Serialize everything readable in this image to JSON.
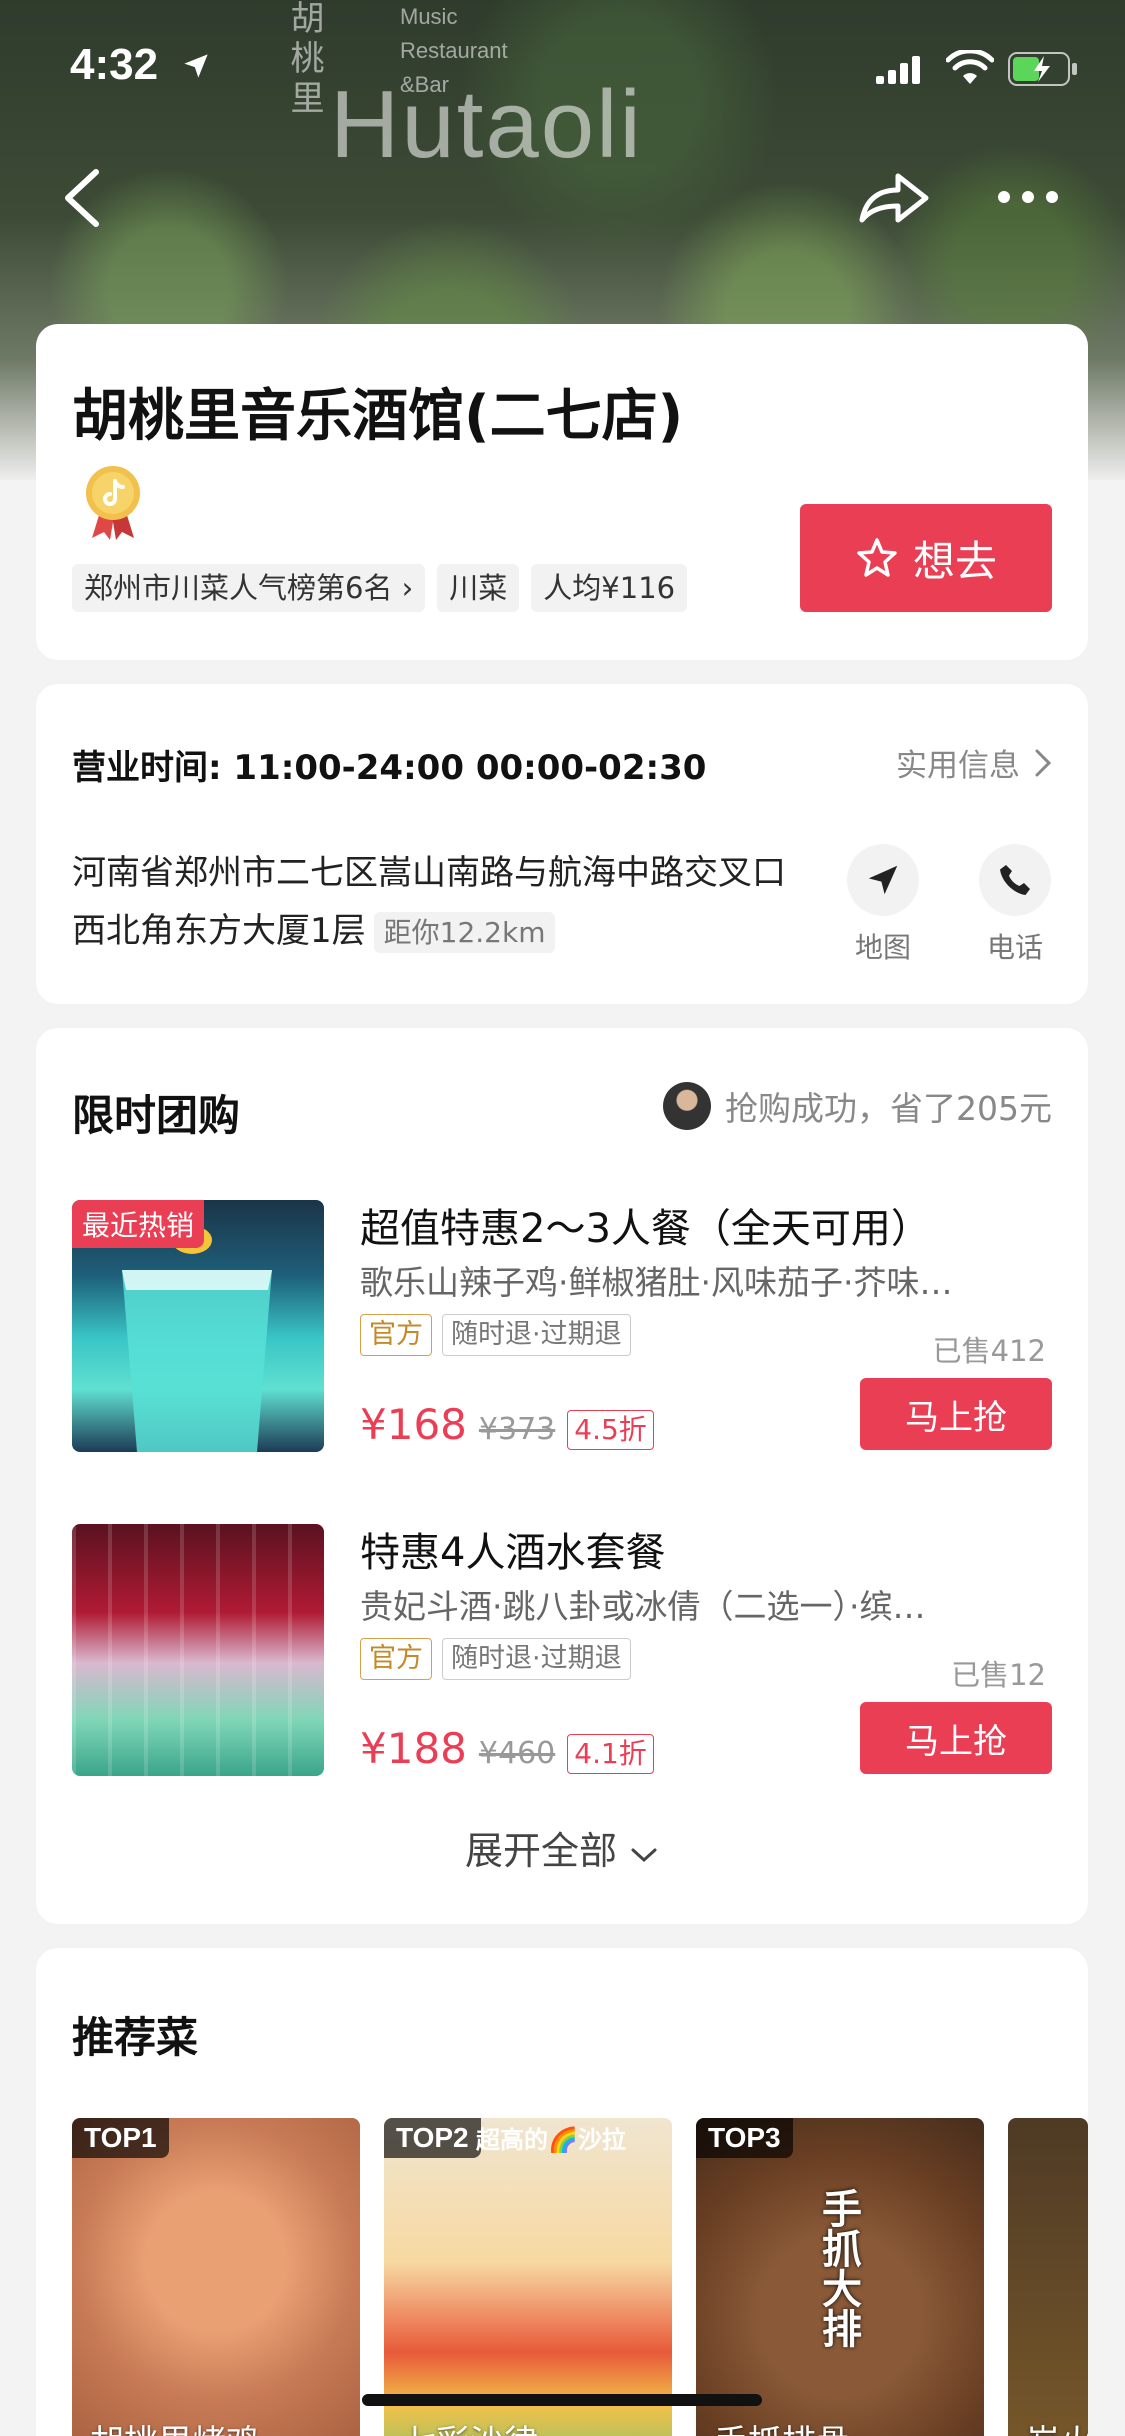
{
  "status_bar": {
    "time": "4:32"
  },
  "hero": {
    "sign_cn": "胡桃里",
    "sign_en_small": [
      "Music",
      "Restaurant",
      "&Bar"
    ],
    "sign_en_big": "Hutaoli"
  },
  "shop": {
    "name": "胡桃里音乐酒馆(二七店)",
    "tags": [
      "郑州市川菜人气榜第6名",
      "川菜",
      "人均¥116"
    ],
    "want_label": "想去"
  },
  "info": {
    "hours": "营业时间: 11:00-24:00 00:00-02:30",
    "practical_label": "实用信息",
    "address": "河南省郑州市二七区嵩山南路与航海中路交叉口西北角东方大厦1层",
    "distance": "距你12.2km",
    "map_label": "地图",
    "phone_label": "电话"
  },
  "deals": {
    "title": "限时团购",
    "hint": "抢购成功，省了205元",
    "items": [
      {
        "badge": "最近热销",
        "name": "超值特惠2～3人餐（全天可用）",
        "desc": "歌乐山辣子鸡·鲜椒猪肚·风味茄子·芥味…",
        "tag_official": "官方",
        "tag_refund": "随时退·过期退",
        "sold": "已售412",
        "price": "¥168",
        "old_price": "¥373",
        "discount": "4.5折",
        "buy_label": "马上抢"
      },
      {
        "name": "特惠4人酒水套餐",
        "desc": "贵妃斗酒·跳八卦或冰倩（二选一）·缤…",
        "tag_official": "官方",
        "tag_refund": "随时退·过期退",
        "sold": "已售12",
        "price": "¥188",
        "old_price": "¥460",
        "discount": "4.1折",
        "buy_label": "马上抢"
      }
    ],
    "expand_label": "展开全部"
  },
  "dishes": {
    "title": "推荐菜",
    "items": [
      {
        "rank": "TOP1",
        "name": "胡桃里烤鸡"
      },
      {
        "rank": "TOP2",
        "name": "七彩沙律",
        "overlay": "超高的🌈沙拉"
      },
      {
        "rank": "TOP3",
        "name": "手抓排骨",
        "overlay": "手抓大排"
      },
      {
        "name": "炭火"
      }
    ]
  }
}
